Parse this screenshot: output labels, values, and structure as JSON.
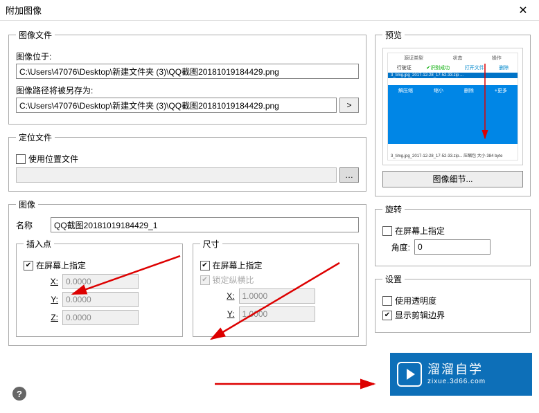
{
  "window": {
    "title": "附加图像",
    "close": "✕"
  },
  "image_file": {
    "legend": "图像文件",
    "located_label": "图像位于:",
    "located_value": "C:\\Users\\47076\\Desktop\\新建文件夹 (3)\\QQ截图20181019184429.png",
    "save_as_label": "图像路径将被另存为:",
    "save_as_value": "C:\\Users\\47076\\Desktop\\新建文件夹 (3)\\QQ截图20181019184429.png"
  },
  "locate_file": {
    "legend": "定位文件",
    "use_loc_label": "使用位置文件",
    "path_value": ""
  },
  "image": {
    "legend": "图像",
    "name_label": "名称",
    "name_value": "QQ截图20181019184429_1",
    "insert_point": {
      "legend": "插入点",
      "on_screen_label": "在屏幕上指定",
      "x_label": "X:",
      "x_value": "0.0000",
      "y_label": "Y:",
      "y_value": "0.0000",
      "z_label": "Z:",
      "z_value": "0.0000"
    },
    "size": {
      "legend": "尺寸",
      "on_screen_label": "在屏幕上指定",
      "lock_ratio_label": "锁定纵横比",
      "x_label": "X:",
      "x_value": "1.0000",
      "y_label": "Y:",
      "y_value": "1.0000"
    }
  },
  "preview": {
    "legend": "预览",
    "detail_btn": "图像细节...",
    "hdr": {
      "a": "源证类型",
      "b": "状态",
      "c": "操作"
    },
    "hdr2": {
      "a": "行驶证",
      "b": "✔识别成功",
      "c": "打开文件",
      "d": "删除"
    },
    "file_row": "3_timg.jpg_2017-12-28_17-52-33.zip ...",
    "mid": {
      "a": "解压缩",
      "b": "缩小",
      "c": "删除",
      "d": "+更多"
    },
    "ftr": "3_timg.jpg_2017-12-28_17-52-33.zip... 压缩包 大小 384 byte"
  },
  "rotation": {
    "legend": "旋转",
    "on_screen_label": "在屏幕上指定",
    "angle_label": "角度:",
    "angle_value": "0"
  },
  "settings": {
    "legend": "设置",
    "transparency_label": "使用透明度",
    "clip_label": "显示剪辑边界"
  },
  "watermark": {
    "big": "溜溜自学",
    "small": "zixue.3d66.com"
  },
  "help": "?"
}
